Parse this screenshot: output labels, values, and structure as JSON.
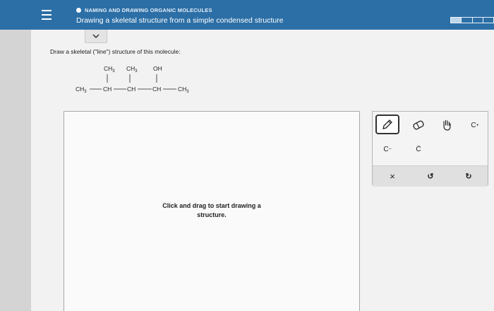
{
  "header": {
    "topic": "NAMING AND DRAWING ORGANIC MOLECULES",
    "title": "Drawing a skeletal structure from a simple condensed structure"
  },
  "progress": {
    "segments": 4,
    "completed": 1
  },
  "question": {
    "instruction": "Draw a skeletal (\"line\") structure of this molecule:",
    "molecule": {
      "top": [
        "CH3",
        "CH3",
        "OH"
      ],
      "main": [
        "CH3",
        "CH",
        "CH",
        "CH",
        "CH3"
      ]
    }
  },
  "canvas": {
    "hint_line1": "Click and drag to start drawing a",
    "hint_line2": "structure."
  },
  "toolbar": {
    "pencil": "pencil-icon",
    "eraser": "eraser-icon",
    "hand": "hand-icon",
    "cation_label": "C",
    "cation_sup": "+",
    "anion_label": "C",
    "anion_sup": "−",
    "lone_pair_label": "C̈",
    "clear_label": "×",
    "undo_label": "↺",
    "redo_label": "↻"
  },
  "colors": {
    "header": "#2c6fa6",
    "background": "#f2f2f2"
  }
}
